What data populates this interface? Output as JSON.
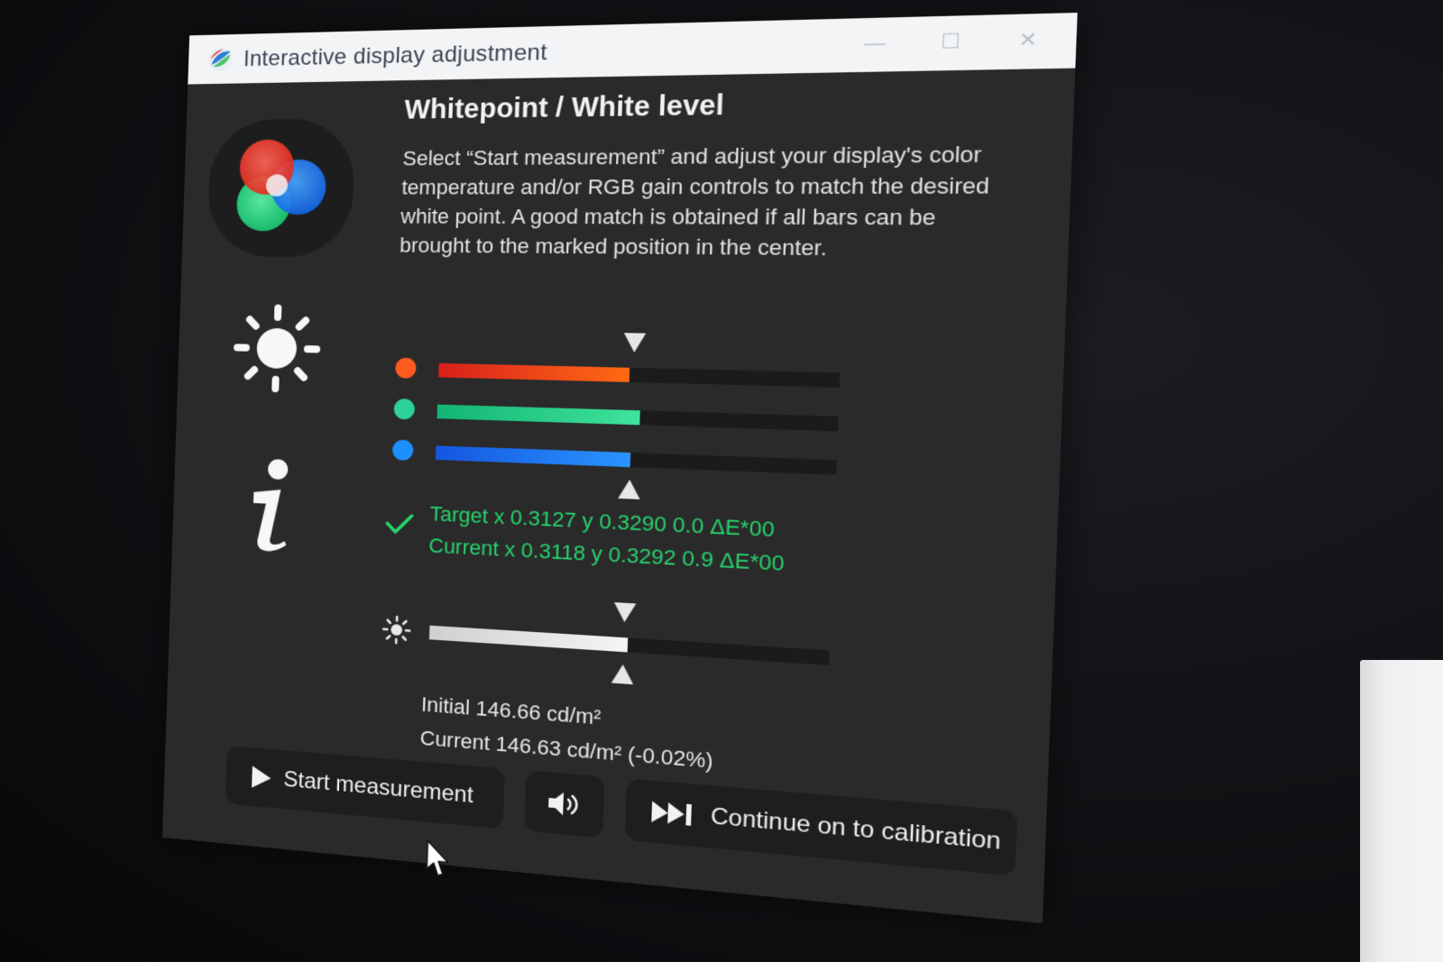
{
  "window": {
    "title": "Interactive display adjustment",
    "controls": {
      "minimize": "—",
      "maximize": "☐",
      "close": "✕"
    }
  },
  "sidebar": {
    "items": [
      {
        "name": "whitepoint",
        "icon": "rgb-circles-icon",
        "active": true
      },
      {
        "name": "brightness",
        "icon": "sun-icon",
        "active": false
      },
      {
        "name": "info",
        "icon": "info-icon",
        "active": false
      }
    ]
  },
  "section": {
    "heading": "Whitepoint / White level",
    "instructions": "Select “Start measurement” and adjust your display's color temperature and/or RGB gain controls to match the desired white point. A good match is obtained if all bars can be brought to the marked position in the center."
  },
  "rgb_bars": [
    {
      "channel": "red",
      "level": 0.49,
      "dot_color": "#ff5a1f",
      "gradient": [
        "#d9201c",
        "#ff6a12"
      ]
    },
    {
      "channel": "green",
      "level": 0.52,
      "dot_color": "#2fd19a",
      "gradient": [
        "#12b574",
        "#3fe39a"
      ]
    },
    {
      "channel": "blue",
      "level": 0.5,
      "dot_color": "#1e8fff",
      "gradient": [
        "#1456e0",
        "#2a94ff"
      ]
    }
  ],
  "target_marker": 0.5,
  "whitepoint_readout": {
    "target": "Target x 0.3127 y 0.3290 0.0 ΔE*00",
    "current": "Current x 0.3118 y 0.3292 0.9 ΔE*00",
    "status_color": "#27d36b"
  },
  "luminance_bar": {
    "level": 0.51,
    "icon": "sun-small-icon"
  },
  "luminance_readout": {
    "initial": "Initial 146.66 cd/m²",
    "current": "Current 146.63 cd/m² (-0.02%)"
  },
  "buttons": {
    "start": {
      "label": "Start measurement",
      "icon": "play-icon"
    },
    "sound": {
      "icon": "speaker-icon"
    },
    "continue": {
      "label": "Continue on to calibration",
      "icon": "skip-forward-icon"
    }
  }
}
